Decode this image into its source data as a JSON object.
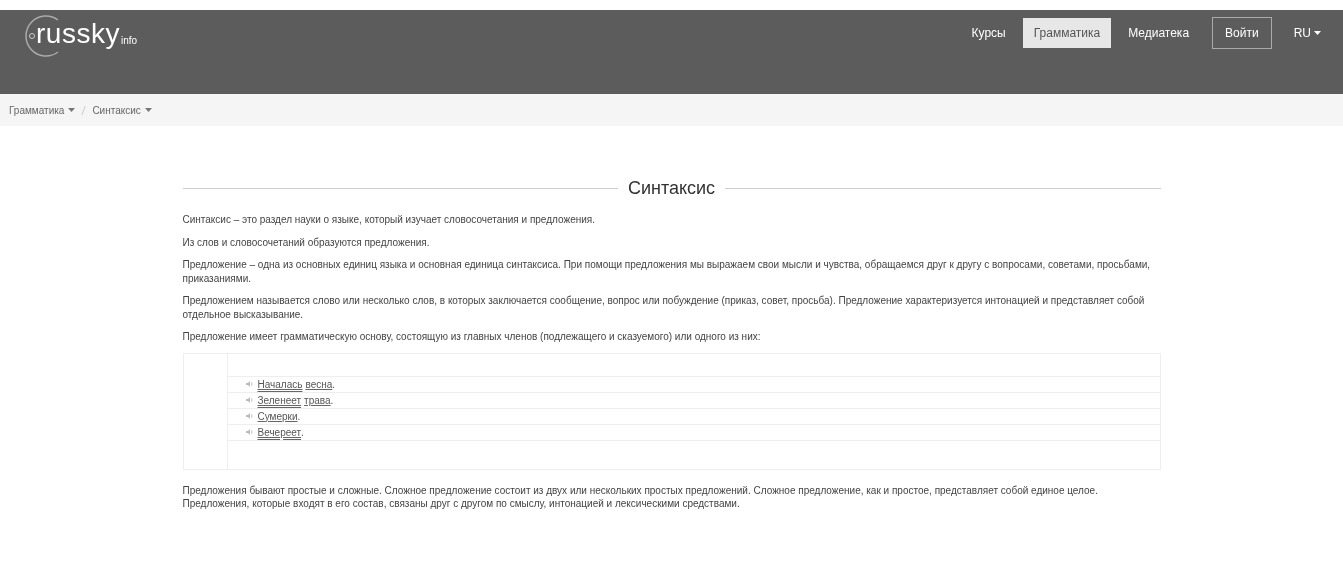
{
  "logo": {
    "main": "russky",
    "suffix": "info"
  },
  "nav": [
    {
      "label": "Курсы",
      "selected": false
    },
    {
      "label": "Грамматика",
      "selected": true
    },
    {
      "label": "Медиатека",
      "selected": false
    }
  ],
  "login": "Войти",
  "language": "RU",
  "breadcrumbs": [
    "Грамматика",
    "Синтаксис"
  ],
  "title": "Синтаксис",
  "paragraphs_before": [
    "Синтаксис – это раздел науки о языке, который изучает словосочетания и предложения.",
    "Из слов и словосочетаний образуются предложения.",
    "Предложение – одна из основных единиц языка и основная единица синтаксиса. При помощи предложения мы выражаем свои мысли и чувства, обращаемся друг к другу с вопросами, советами, просьбами, приказаниями.",
    "Предложением называется слово или несколько слов, в которых заключается сообщение, вопрос или побуждение (приказ, совет, просьба). Предложение характеризуется интонацией и представляет собой отдельное высказывание.",
    "Предложение имеет грамматическую основу, состоящую из главных членов (подлежащего и сказуемого) или одного из них:"
  ],
  "examples": [
    {
      "words": [
        {
          "text": "Началась",
          "kind": "predicate"
        },
        {
          "text": "весна",
          "kind": "subject"
        }
      ]
    },
    {
      "words": [
        {
          "text": "Зеленеет",
          "kind": "predicate"
        },
        {
          "text": "трава",
          "kind": "subject"
        }
      ]
    },
    {
      "words": [
        {
          "text": "Сумерки",
          "kind": "subject"
        }
      ]
    },
    {
      "words": [
        {
          "text": "Вечереет",
          "kind": "predicate"
        }
      ]
    }
  ],
  "example_end": ".",
  "paragraphs_after": [
    "Предложения бывают простые и сложные. Сложное предложение состоит из двух или нескольких простых предложений. Сложное предложение, как и простое, представляет собой единое целое. Предложения, которые входят в его состав, связаны друг с другом по смыслу, интонацией и лексическими средствами."
  ]
}
